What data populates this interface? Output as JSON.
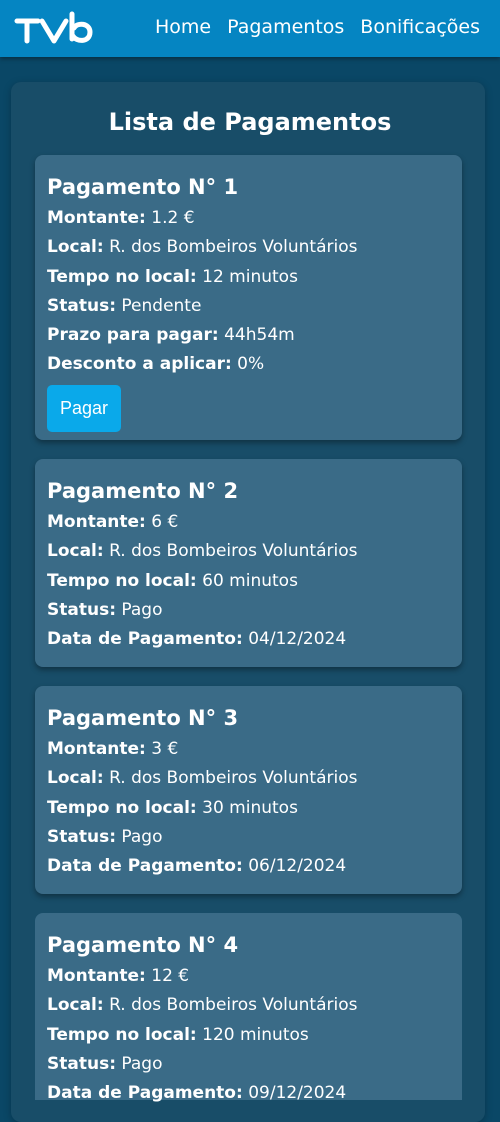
{
  "header": {
    "logo_text": "TVB",
    "nav": [
      "Home",
      "Pagamentos",
      "Bonificações"
    ]
  },
  "main": {
    "title": "Lista de Pagamentos",
    "labels": {
      "amount": "Montante:",
      "location": "Local:",
      "time": "Tempo no local:",
      "status": "Status:",
      "deadline": "Prazo para pagar:",
      "discount": "Desconto a aplicar:",
      "paid_date": "Data de Pagamento:"
    },
    "payments": [
      {
        "title": "Pagamento N° 1",
        "amount": "1.2 €",
        "location": "R. dos Bombeiros Voluntários",
        "time": "12 minutos",
        "status": "Pendente",
        "deadline": "44h54m",
        "discount": "0%",
        "button": "Pagar"
      },
      {
        "title": "Pagamento N° 2",
        "amount": "6 €",
        "location": "R. dos Bombeiros Voluntários",
        "time": "60 minutos",
        "status": "Pago",
        "paid_date": "04/12/2024"
      },
      {
        "title": "Pagamento N° 3",
        "amount": "3 €",
        "location": "R. dos Bombeiros Voluntários",
        "time": "30 minutos",
        "status": "Pago",
        "paid_date": "06/12/2024"
      },
      {
        "title": "Pagamento N° 4",
        "amount": "12 €",
        "location": "R. dos Bombeiros Voluntários",
        "time": "120 minutos",
        "status": "Pago",
        "paid_date": "09/12/2024"
      }
    ]
  }
}
